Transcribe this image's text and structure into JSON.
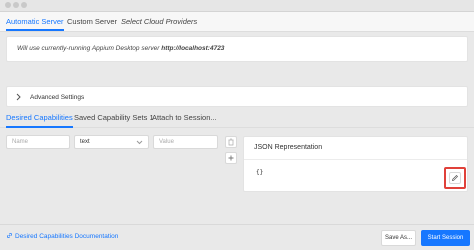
{
  "server_tabs": [
    {
      "label": "Automatic Server",
      "active": true
    },
    {
      "label": "Custom Server",
      "active": false
    },
    {
      "label": "Select Cloud Providers",
      "active": false
    }
  ],
  "info": {
    "prefix": "Will use currently-running Appium Desktop server",
    "url": "http://localhost:4723"
  },
  "advanced_settings_label": "Advanced Settings",
  "capability_tabs": [
    {
      "label": "Desired Capabilities",
      "active": true
    },
    {
      "label": "Saved Capability Sets 1",
      "active": false
    },
    {
      "label": "Attach to Session...",
      "active": false
    }
  ],
  "capability_row": {
    "name_placeholder": "Name",
    "type_value": "text",
    "value_placeholder": "Value"
  },
  "json_panel": {
    "title": "JSON Representation",
    "content": "{}"
  },
  "footer": {
    "doc_link": "Desired Capabilities Documentation",
    "save_as": "Save As...",
    "start_session": "Start Session"
  },
  "colors": {
    "accent": "#1677ff",
    "highlight": "#e0413a"
  },
  "icons": [
    "chevron-right-icon",
    "chevron-down-icon",
    "trash-icon",
    "plus-icon",
    "pencil-icon",
    "link-icon"
  ]
}
